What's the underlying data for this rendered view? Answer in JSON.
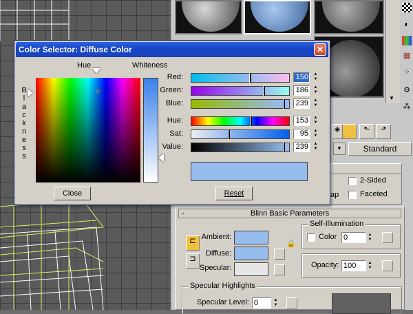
{
  "dialog": {
    "title": "Color Selector: Diffuse Color",
    "close_glyph": "✕",
    "hue_label": "Hue",
    "whiteness_label": "Whiteness",
    "blackness_letters": [
      "B",
      "l",
      "a",
      "c",
      "k",
      "n",
      "e",
      "s",
      "s"
    ],
    "close_button": "Close",
    "reset_button": "Reset",
    "result_color": "#96bdee",
    "rgb": [
      {
        "label": "Red:",
        "value": "150",
        "fraction": 0.59
      },
      {
        "label": "Green:",
        "value": "186",
        "fraction": 0.73
      },
      {
        "label": "Blue:",
        "value": "239",
        "fraction": 0.94
      }
    ],
    "hsv": [
      {
        "label": "Hue:",
        "value": "153",
        "fraction": 0.6
      },
      {
        "label": "Sat:",
        "value": "95",
        "fraction": 0.37
      },
      {
        "label": "Value:",
        "value": "239",
        "fraction": 0.94
      }
    ]
  },
  "material_editor": {
    "type_button": "Standard",
    "shader_checks": [
      {
        "label": "2-Sided"
      },
      {
        "label": "Faceted"
      }
    ],
    "map_fragment": "ap",
    "blinn_rollout_title": "Blinn Basic Parameters",
    "ambient_label": "Ambient:",
    "diffuse_label": "Diffuse:",
    "specular_label": "Specular:",
    "ambient_color": "#96bdee",
    "diffuse_color": "#96bdee",
    "specular_color": "#e6e6e6",
    "self_illum_title": "Self-Illumination",
    "color_label": "Color",
    "color_value": "0",
    "opacity_label": "Opacity:",
    "opacity_value": "100",
    "spec_highlights_title": "Specular Highlights",
    "spec_level_label": "Specular Level:",
    "spec_level_value": "0"
  }
}
